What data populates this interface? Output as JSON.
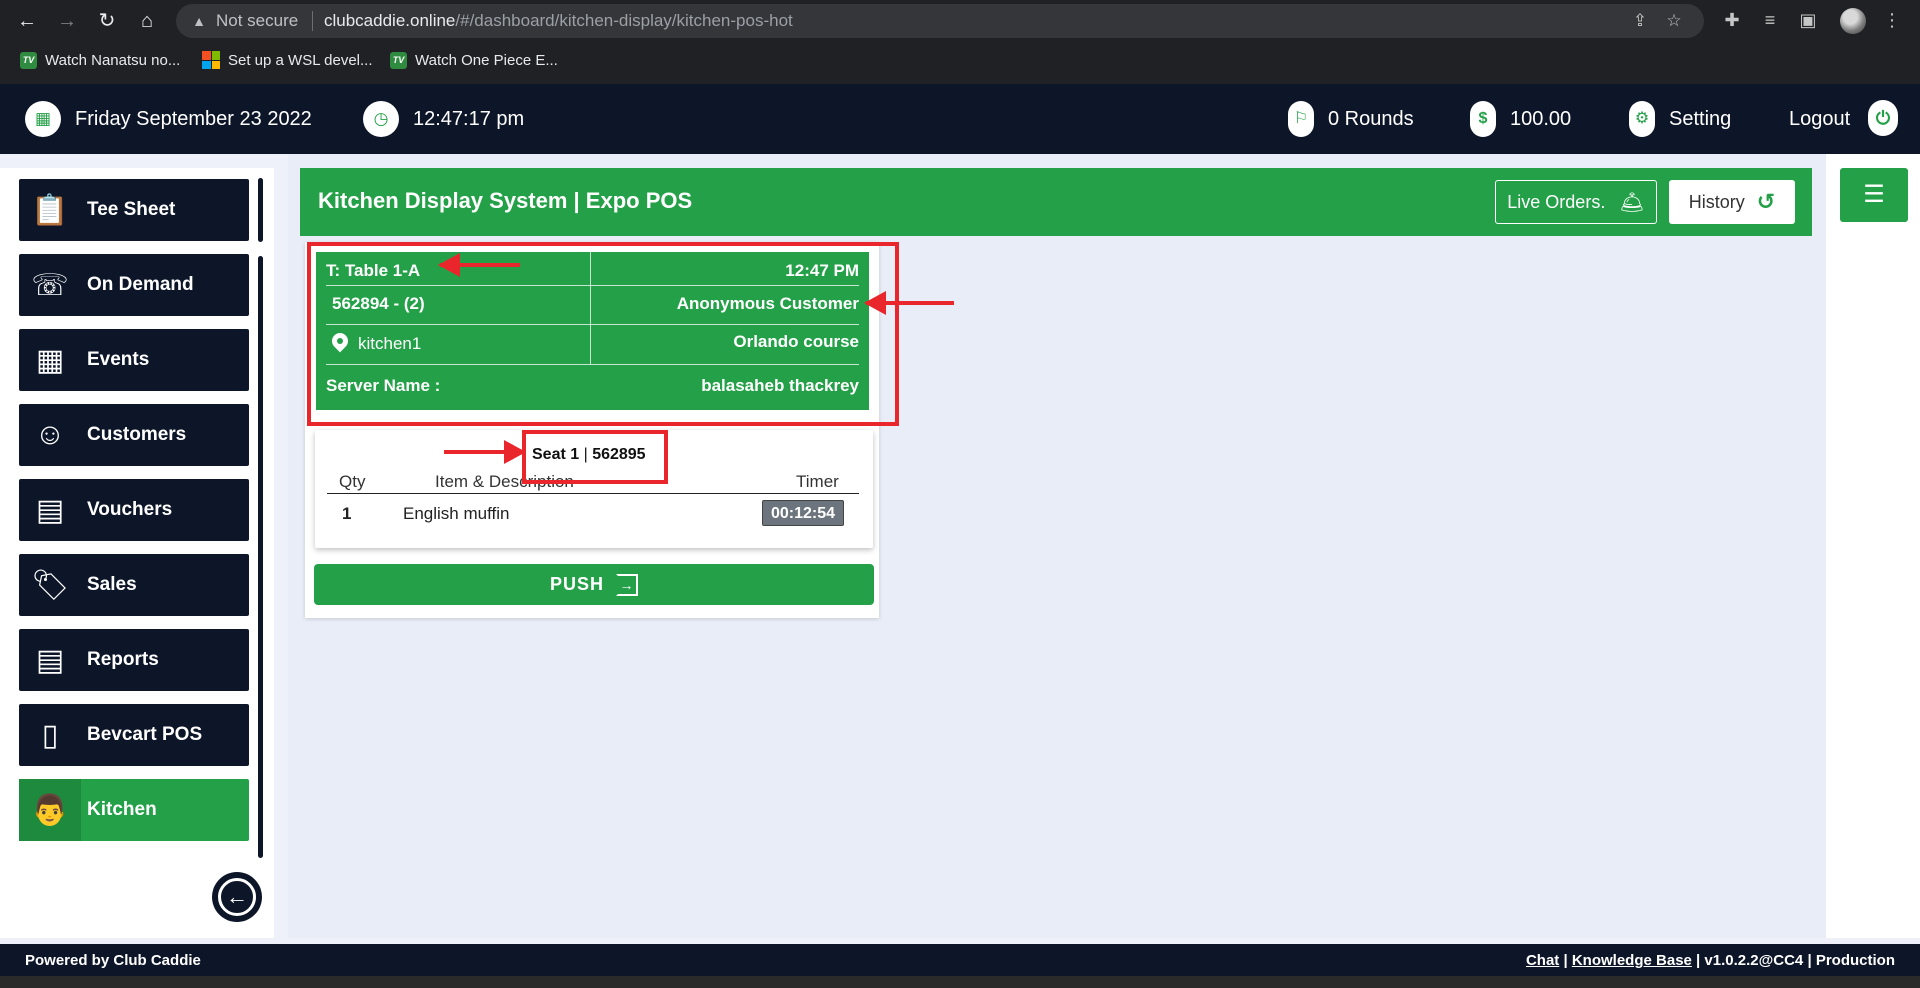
{
  "browser": {
    "security_label": "Not secure",
    "url_host": "clubcaddie.online",
    "url_path": "/#/dashboard/kitchen-display/kitchen-pos-hot",
    "bookmarks": [
      {
        "label": "Watch Nanatsu no...",
        "icon": "tv-icon"
      },
      {
        "label": "Set up a WSL devel...",
        "icon": "microsoft-icon"
      },
      {
        "label": "Watch One Piece E...",
        "icon": "tv-icon"
      }
    ]
  },
  "header": {
    "date": "Friday September 23 2022",
    "time": "12:47:17 pm",
    "rounds": "0 Rounds",
    "balance": "100.00",
    "setting": "Setting",
    "logout": "Logout"
  },
  "sidebar": {
    "items": [
      {
        "label": "Tee Sheet",
        "icon": "clipboard-icon"
      },
      {
        "label": "On Demand",
        "icon": "phone-clock-icon"
      },
      {
        "label": "Events",
        "icon": "calendar-icon"
      },
      {
        "label": "Customers",
        "icon": "customers-icon"
      },
      {
        "label": "Vouchers",
        "icon": "voucher-icon"
      },
      {
        "label": "Sales",
        "icon": "sale-tag-icon"
      },
      {
        "label": "Reports",
        "icon": "report-icon"
      },
      {
        "label": "Bevcart POS",
        "icon": "mobile-icon"
      },
      {
        "label": "Kitchen",
        "icon": "chef-icon",
        "active": true
      }
    ]
  },
  "kds": {
    "title": "Kitchen Display System | Expo POS",
    "live_orders": "Live Orders.",
    "history": "History"
  },
  "order": {
    "table": "T: Table 1-A",
    "time": "12:47 PM",
    "order_no": "562894 - (2)",
    "customer": "Anonymous Customer",
    "location": "kitchen1",
    "course": "Orlando course",
    "server_label": "Server Name :",
    "server_name": "balasaheb thackrey",
    "seat_label": "Seat 1",
    "seat_number": "562895",
    "columns": {
      "qty": "Qty",
      "item": "Item & Description",
      "timer": "Timer"
    },
    "items": [
      {
        "qty": "1",
        "name": "English muffin",
        "timer": "00:12:54"
      }
    ],
    "push_label": "PUSH"
  },
  "footer": {
    "powered": "Powered by Club Caddie",
    "chat": "Chat",
    "kb": "Knowledge Base",
    "version": "v1.0.2.2@CC4",
    "env": "Production"
  }
}
